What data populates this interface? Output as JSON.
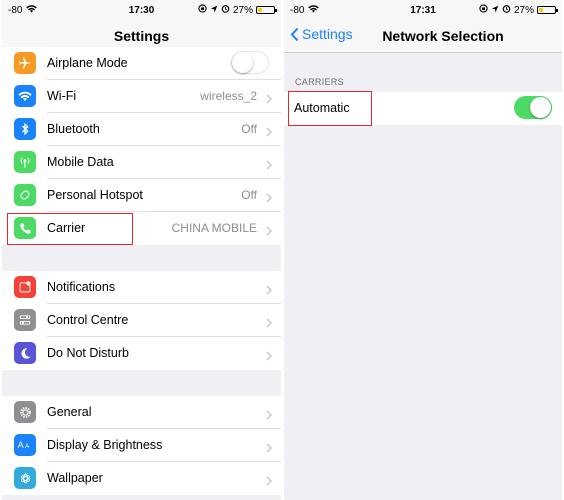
{
  "left": {
    "status": {
      "signal": "-80",
      "time": "17:30",
      "battery": "27%",
      "battery_level": 0.27
    },
    "title": "Settings",
    "group1": [
      {
        "label": "Airplane Mode",
        "value": "",
        "icon": "airplane-icon",
        "color": "#f59a23",
        "toggle": "off"
      },
      {
        "label": "Wi-Fi",
        "value": "wireless_2",
        "icon": "wifi-icon",
        "color": "#1a82fb"
      },
      {
        "label": "Bluetooth",
        "value": "Off",
        "icon": "bluetooth-icon",
        "color": "#1a82fb"
      },
      {
        "label": "Mobile Data",
        "value": "",
        "icon": "antenna-icon",
        "color": "#4cd964"
      },
      {
        "label": "Personal Hotspot",
        "value": "Off",
        "icon": "hotspot-icon",
        "color": "#4cd964"
      },
      {
        "label": "Carrier",
        "value": "CHINA MOBILE",
        "icon": "phone-icon",
        "color": "#4cd964"
      }
    ],
    "group2": [
      {
        "label": "Notifications",
        "value": "",
        "icon": "notifications-icon",
        "color": "#f44336"
      },
      {
        "label": "Control Centre",
        "value": "",
        "icon": "control-centre-icon",
        "color": "#8e8e93"
      },
      {
        "label": "Do Not Disturb",
        "value": "",
        "icon": "moon-icon",
        "color": "#5856d6"
      }
    ],
    "group3": [
      {
        "label": "General",
        "value": "",
        "icon": "gear-icon",
        "color": "#8e8e93"
      },
      {
        "label": "Display & Brightness",
        "value": "",
        "icon": "display-icon",
        "color": "#1a82fb"
      },
      {
        "label": "Wallpaper",
        "value": "",
        "icon": "wallpaper-icon",
        "color": "#34aadc"
      }
    ]
  },
  "right": {
    "status": {
      "signal": "-80",
      "time": "17:31",
      "battery": "27%",
      "battery_level": 0.27
    },
    "back_label": "Settings",
    "title": "Network Selection",
    "section_header": "CARRIERS",
    "automatic_label": "Automatic",
    "automatic_toggle": "on"
  },
  "colors": {
    "accent": "#1a82fb",
    "toggle_on": "#4cd964",
    "highlight": "#e3262f"
  }
}
